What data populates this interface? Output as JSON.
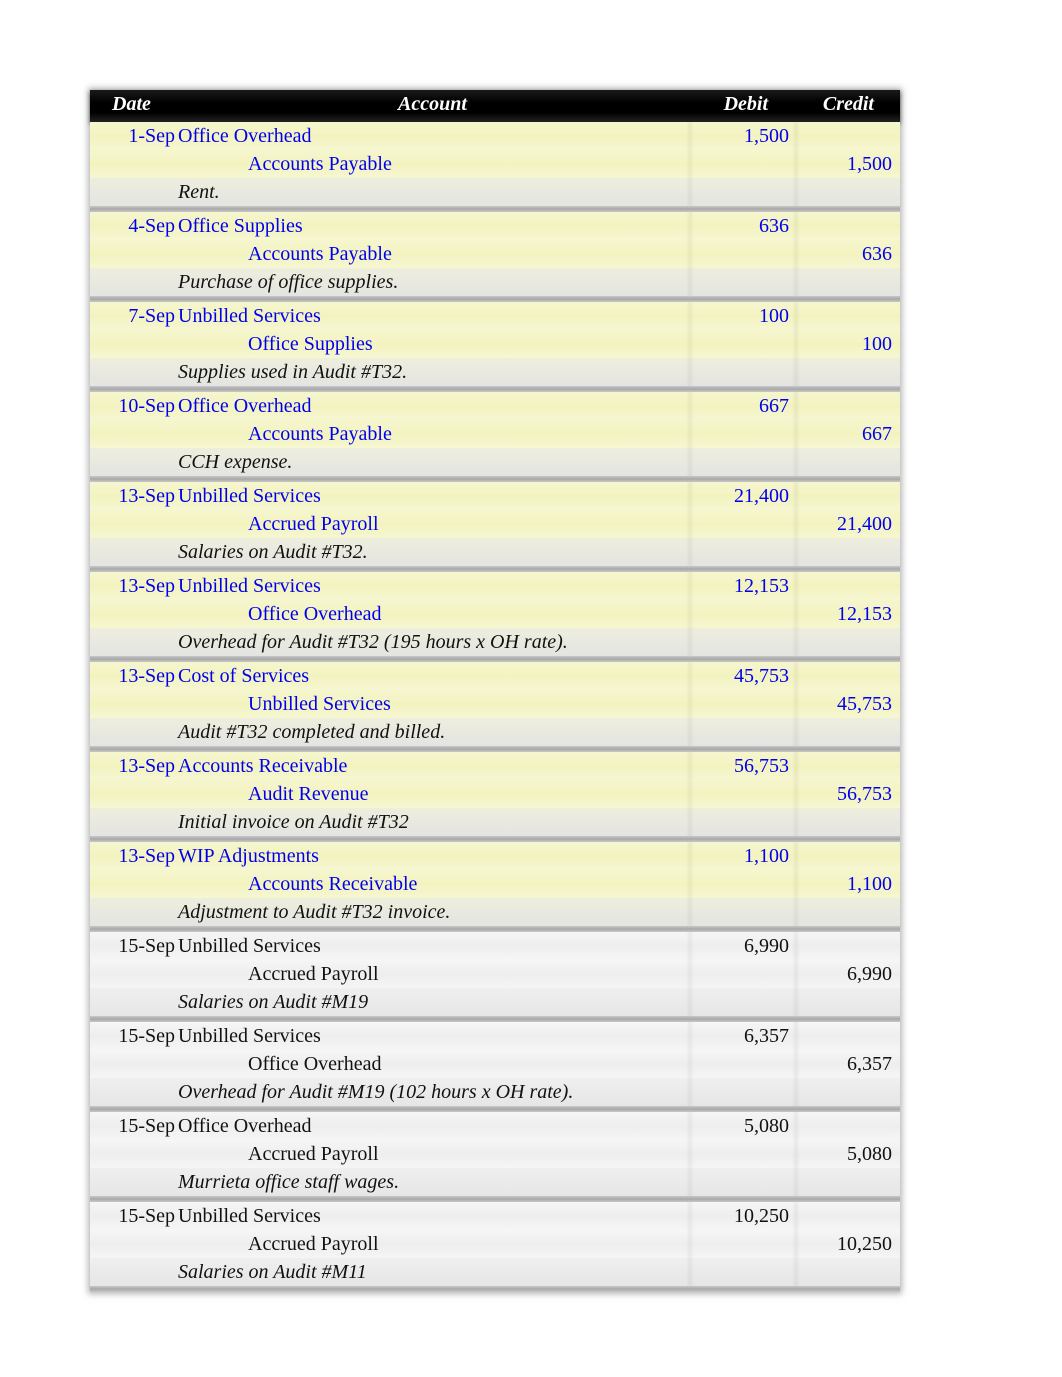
{
  "header": {
    "date": "Date",
    "account": "Account",
    "debit": "Debit",
    "credit": "Credit"
  },
  "entries": [
    {
      "date": "1-Sep",
      "debit_account": "Office Overhead",
      "credit_account": "Accounts Payable",
      "debit": "1,500",
      "credit": "1,500",
      "memo": "Rent.",
      "highlight": "yellow"
    },
    {
      "date": "4-Sep",
      "debit_account": "Office Supplies",
      "credit_account": "Accounts Payable",
      "debit": "636",
      "credit": "636",
      "memo": "Purchase of office supplies.",
      "highlight": "yellow"
    },
    {
      "date": "7-Sep",
      "debit_account": "Unbilled Services",
      "credit_account": "Office Supplies",
      "debit": "100",
      "credit": "100",
      "memo": "Supplies used in Audit #T32.",
      "highlight": "yellow"
    },
    {
      "date": "10-Sep",
      "debit_account": "Office Overhead",
      "credit_account": "Accounts Payable",
      "debit": "667",
      "credit": "667",
      "memo": "CCH expense.",
      "highlight": "yellow"
    },
    {
      "date": "13-Sep",
      "debit_account": "Unbilled Services",
      "credit_account": "Accrued Payroll",
      "debit": "21,400",
      "credit": "21,400",
      "memo": "Salaries on Audit #T32.",
      "highlight": "yellow"
    },
    {
      "date": "13-Sep",
      "debit_account": "Unbilled Services",
      "credit_account": "Office Overhead",
      "debit": "12,153",
      "credit": "12,153",
      "memo": "Overhead for Audit #T32 (195 hours x OH rate).",
      "highlight": "yellow"
    },
    {
      "date": "13-Sep",
      "debit_account": "Cost of Services",
      "credit_account": "Unbilled Services",
      "debit": "45,753",
      "credit": "45,753",
      "memo": "Audit #T32 completed and billed.",
      "highlight": "yellow"
    },
    {
      "date": "13-Sep",
      "debit_account": "Accounts Receivable",
      "credit_account": "Audit Revenue",
      "debit": "56,753",
      "credit": "56,753",
      "memo": "Initial invoice on Audit #T32",
      "highlight": "yellow"
    },
    {
      "date": "13-Sep",
      "debit_account": "WIP Adjustments",
      "credit_account": "Accounts Receivable",
      "debit": "1,100",
      "credit": "1,100",
      "memo": "Adjustment to Audit #T32 invoice.",
      "highlight": "yellow"
    },
    {
      "date": "15-Sep",
      "debit_account": "Unbilled Services",
      "credit_account": "Accrued Payroll",
      "debit": "6,990",
      "credit": "6,990",
      "memo": "Salaries on Audit #M19",
      "highlight": "grey"
    },
    {
      "date": "15-Sep",
      "debit_account": "Unbilled Services",
      "credit_account": "Office Overhead",
      "debit": "6,357",
      "credit": "6,357",
      "memo": "Overhead for Audit #M19 (102 hours x OH rate).",
      "highlight": "grey"
    },
    {
      "date": "15-Sep",
      "debit_account": "Office Overhead",
      "credit_account": "Accrued Payroll",
      "debit": "5,080",
      "credit": "5,080",
      "memo": "Murrieta office staff wages.",
      "highlight": "grey"
    },
    {
      "date": "15-Sep",
      "debit_account": "Unbilled Services",
      "credit_account": "Accrued Payroll",
      "debit": "10,250",
      "credit": "10,250",
      "memo": "Salaries on Audit #M11",
      "highlight": "grey"
    }
  ]
}
